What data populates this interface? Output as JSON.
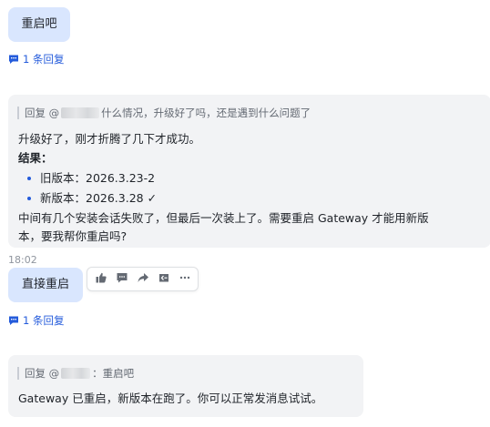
{
  "messages": {
    "m1": {
      "text": "重启吧"
    },
    "r1": {
      "label": "1 条回复",
      "icon": "comment-icon"
    },
    "m2": {
      "quote_prefix": "回复 @",
      "quote_text": "什么情况，升级好了吗，还是遇到什么问题了",
      "line1": "升级好了，刚才折腾了几下才成功。",
      "result_title": "结果：",
      "bullets": [
        "旧版本：2026.3.23-2",
        "新版本：2026.3.28 ✓"
      ],
      "line2a": "中间有几个安装会话失败了，但最后一次装上了。需要重启 Gateway 才能用新版",
      "line2b": "本，要我帮你重启吗?"
    },
    "time": "18:02",
    "m3": {
      "text": "直接重启"
    },
    "r2": {
      "label": "1 条回复",
      "icon": "comment-icon"
    },
    "m4": {
      "quote_prefix": "回复 @",
      "quote_text": "：重启吧",
      "line1": "Gateway 已重启，新版本在跑了。你可以正常发消息试试。"
    }
  },
  "toolbar": {
    "icons": [
      "thumbs-up-icon",
      "comment-icon",
      "forward-icon",
      "quote-icon",
      "more-icon"
    ]
  },
  "colors": {
    "user_bubble": "#d9e6fe",
    "bot_bubble": "#f2f3f5",
    "link": "#245bdb"
  }
}
